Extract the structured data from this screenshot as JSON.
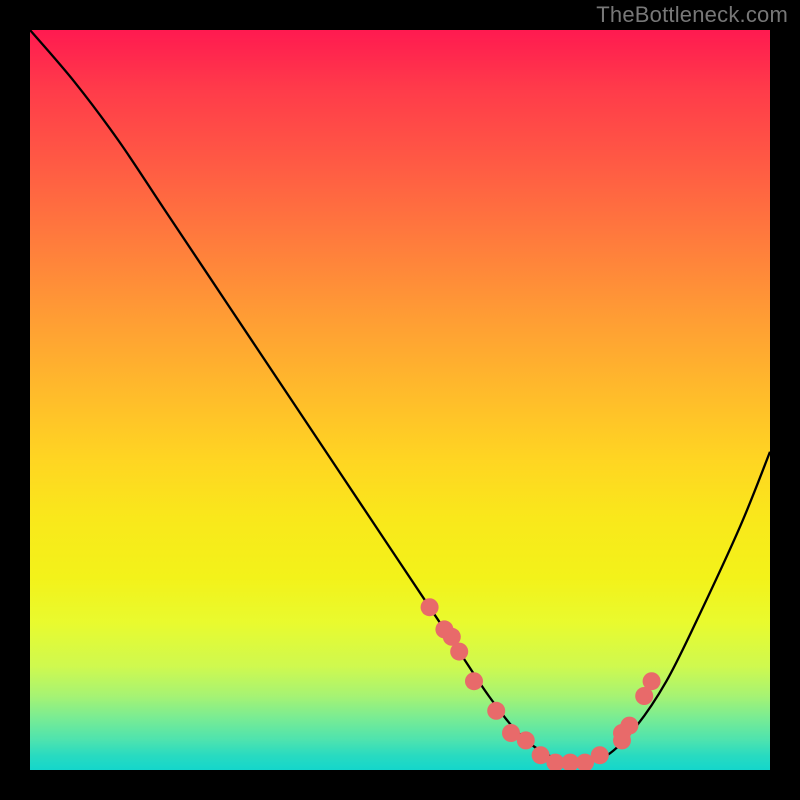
{
  "watermark": "TheBottleneck.com",
  "chart_data": {
    "type": "line",
    "title": "",
    "xlabel": "",
    "ylabel": "",
    "xlim": [
      0,
      100
    ],
    "ylim": [
      0,
      100
    ],
    "grid": false,
    "legend": false,
    "series": [
      {
        "name": "bottleneck-curve",
        "x": [
          0,
          6,
          12,
          18,
          24,
          30,
          36,
          42,
          48,
          54,
          58,
          62,
          66,
          70,
          74,
          78,
          82,
          86,
          90,
          96,
          100
        ],
        "y": [
          100,
          93,
          85,
          76,
          67,
          58,
          49,
          40,
          31,
          22,
          16,
          10,
          5,
          2,
          1,
          2,
          6,
          12,
          20,
          33,
          43
        ]
      }
    ],
    "markers": {
      "name": "highlight-dots",
      "x": [
        54,
        56,
        57,
        58,
        60,
        63,
        65,
        67,
        69,
        71,
        73,
        75,
        77,
        80,
        80,
        81,
        83,
        84
      ],
      "y": [
        22,
        19,
        18,
        16,
        12,
        8,
        5,
        4,
        2,
        1,
        1,
        1,
        2,
        4,
        5,
        6,
        10,
        12
      ]
    },
    "gradient_stops": [
      {
        "pos": 0,
        "color": "#ff1a50"
      },
      {
        "pos": 18,
        "color": "#ff5a44"
      },
      {
        "pos": 38,
        "color": "#ff9a35"
      },
      {
        "pos": 58,
        "color": "#ffd522"
      },
      {
        "pos": 80,
        "color": "#e9fa2e"
      },
      {
        "pos": 93,
        "color": "#78ec94"
      },
      {
        "pos": 100,
        "color": "#14d6cb"
      }
    ]
  }
}
